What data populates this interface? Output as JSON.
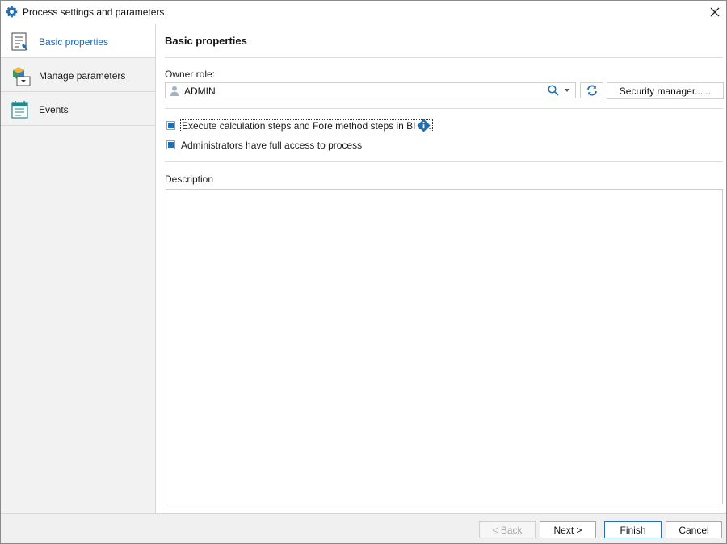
{
  "window": {
    "title": "Process settings and parameters"
  },
  "icons": {
    "title": "gear-icon",
    "close": "close-icon",
    "basic": "properties-list-icon",
    "params": "parameters-cube-icon",
    "events": "calendar-events-icon",
    "user": "user-icon",
    "search": "search-icon",
    "dropdown": "chevron-down-icon",
    "refresh": "refresh-icon",
    "info": "info-icon"
  },
  "colors": {
    "accent": "#1f6fb2",
    "active_text": "#1565c0",
    "sidebar_bg": "#f2f2f2"
  },
  "sidebar": {
    "items": [
      {
        "label": "Basic properties",
        "active": true
      },
      {
        "label": "Manage parameters",
        "active": false
      },
      {
        "label": "Events",
        "active": false
      }
    ]
  },
  "main": {
    "title": "Basic properties",
    "owner_role_label": "Owner role:",
    "owner_role_value": "ADMIN",
    "security_button": "Security manager......",
    "checkboxes": [
      {
        "label": "Execute calculation steps and Fore method steps in BI s...",
        "checked": true
      },
      {
        "label": "Administrators have full access to process",
        "checked": true
      }
    ],
    "description_label": "Description",
    "description_value": ""
  },
  "footer": {
    "back": "< Back",
    "next": "Next >",
    "finish": "Finish",
    "cancel": "Cancel"
  }
}
